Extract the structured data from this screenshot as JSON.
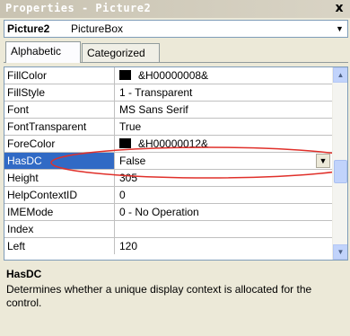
{
  "window": {
    "title": "Properties - Picture2",
    "close_label": "x"
  },
  "object_selector": {
    "name": "Picture2",
    "type": "PictureBox",
    "dropdown_icon": "chevron-down-icon"
  },
  "tabs": [
    {
      "label": "Alphabetic",
      "active": true
    },
    {
      "label": "Categorized",
      "active": false
    }
  ],
  "properties": [
    {
      "name": "FillColor",
      "value": "&H00000008&",
      "swatch": "#000000"
    },
    {
      "name": "FillStyle",
      "value": "1 - Transparent"
    },
    {
      "name": "Font",
      "value": "MS Sans Serif"
    },
    {
      "name": "FontTransparent",
      "value": "True"
    },
    {
      "name": "ForeColor",
      "value": "&H00000012&",
      "swatch": "#000000"
    },
    {
      "name": "HasDC",
      "value": "False",
      "selected": true
    },
    {
      "name": "Height",
      "value": "305"
    },
    {
      "name": "HelpContextID",
      "value": "0"
    },
    {
      "name": "IMEMode",
      "value": "0 - No Operation"
    },
    {
      "name": "Index",
      "value": ""
    },
    {
      "name": "Left",
      "value": "120"
    }
  ],
  "annotation": {
    "color": "#e0302a"
  },
  "description": {
    "title": "HasDC",
    "text": "Determines whether a unique display context is allocated for the control."
  },
  "colors": {
    "selection": "#316ac5",
    "scrollbar": "#c1d3fb"
  }
}
